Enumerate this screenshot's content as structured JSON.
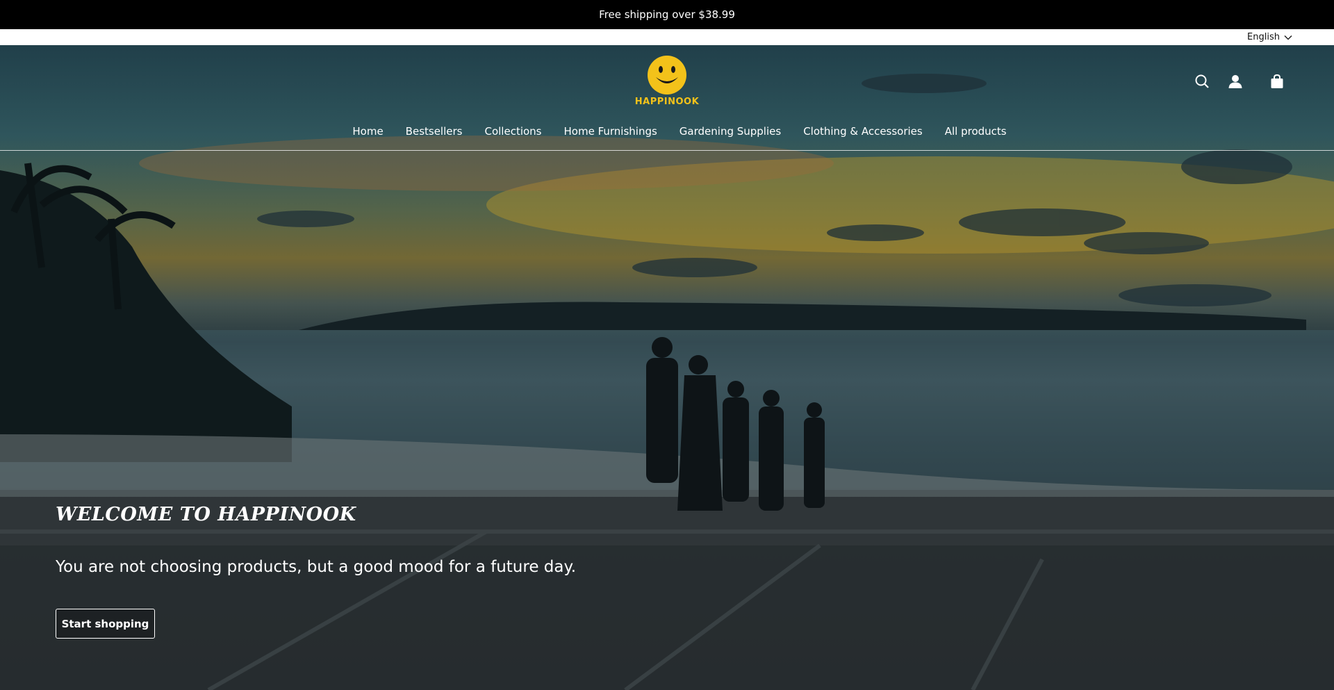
{
  "announcement": {
    "text": "Free shipping over $38.99"
  },
  "language": {
    "selected": "English"
  },
  "brand": {
    "logo_text": "HAPPINOOK",
    "logo_color": "#f3c21a"
  },
  "header_icons": [
    "search-icon",
    "account-icon",
    "cart-icon"
  ],
  "nav": {
    "items": [
      {
        "label": "Home"
      },
      {
        "label": "​Bestsellers"
      },
      {
        "label": "Collections"
      },
      {
        "label": "Home Furnishings"
      },
      {
        "label": "Gardening Supplies"
      },
      {
        "label": "Clothing & Accessories"
      },
      {
        "label": "All products"
      }
    ]
  },
  "hero": {
    "title": "WELCOME TO HAPPINOOK",
    "subtitle": "You are not choosing products, but a good mood for a future day.",
    "cta_label": "Start shopping"
  }
}
